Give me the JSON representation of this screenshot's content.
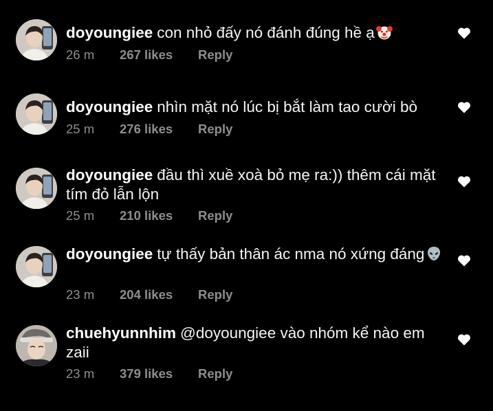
{
  "comments": [
    {
      "username": "doyoungiee",
      "text": "con nhỏ đấy nó đánh đúng hề ạ",
      "emoji": "clown-face-icon",
      "time": "26 m",
      "likes": "267 likes",
      "reply": "Reply",
      "avatar": "avatar-doyoungiee"
    },
    {
      "username": "doyoungiee",
      "text": "nhìn mặt nó lúc bị bắt làm tao cười bò",
      "time": "25 m",
      "likes": "276 likes",
      "reply": "Reply",
      "avatar": "avatar-doyoungiee"
    },
    {
      "username": "doyoungiee",
      "text": "đầu thì xuề xoà bỏ mẹ ra:)) thêm cái mặt tím đỏ lẫn lộn",
      "time": "25 m",
      "likes": "210 likes",
      "reply": "Reply",
      "avatar": "avatar-doyoungiee"
    },
    {
      "username": "doyoungiee",
      "text": "tự thấy bản thân ác nma nó xứng đáng",
      "emoji": "alien-icon",
      "time": "23 m",
      "likes": "204 likes",
      "reply": "Reply",
      "avatar": "avatar-doyoungiee"
    },
    {
      "username": "chuehyunnhim",
      "text": "@doyoungiee vào nhóm kể nào em zaii",
      "time": "23 m",
      "likes": "379 likes",
      "reply": "Reply",
      "avatar": "avatar-chuehyunnhim"
    }
  ],
  "colors": {
    "background": "#000000",
    "text": "#f5f5f5",
    "meta": "#8e8e8e",
    "heart": "#ffffff"
  }
}
